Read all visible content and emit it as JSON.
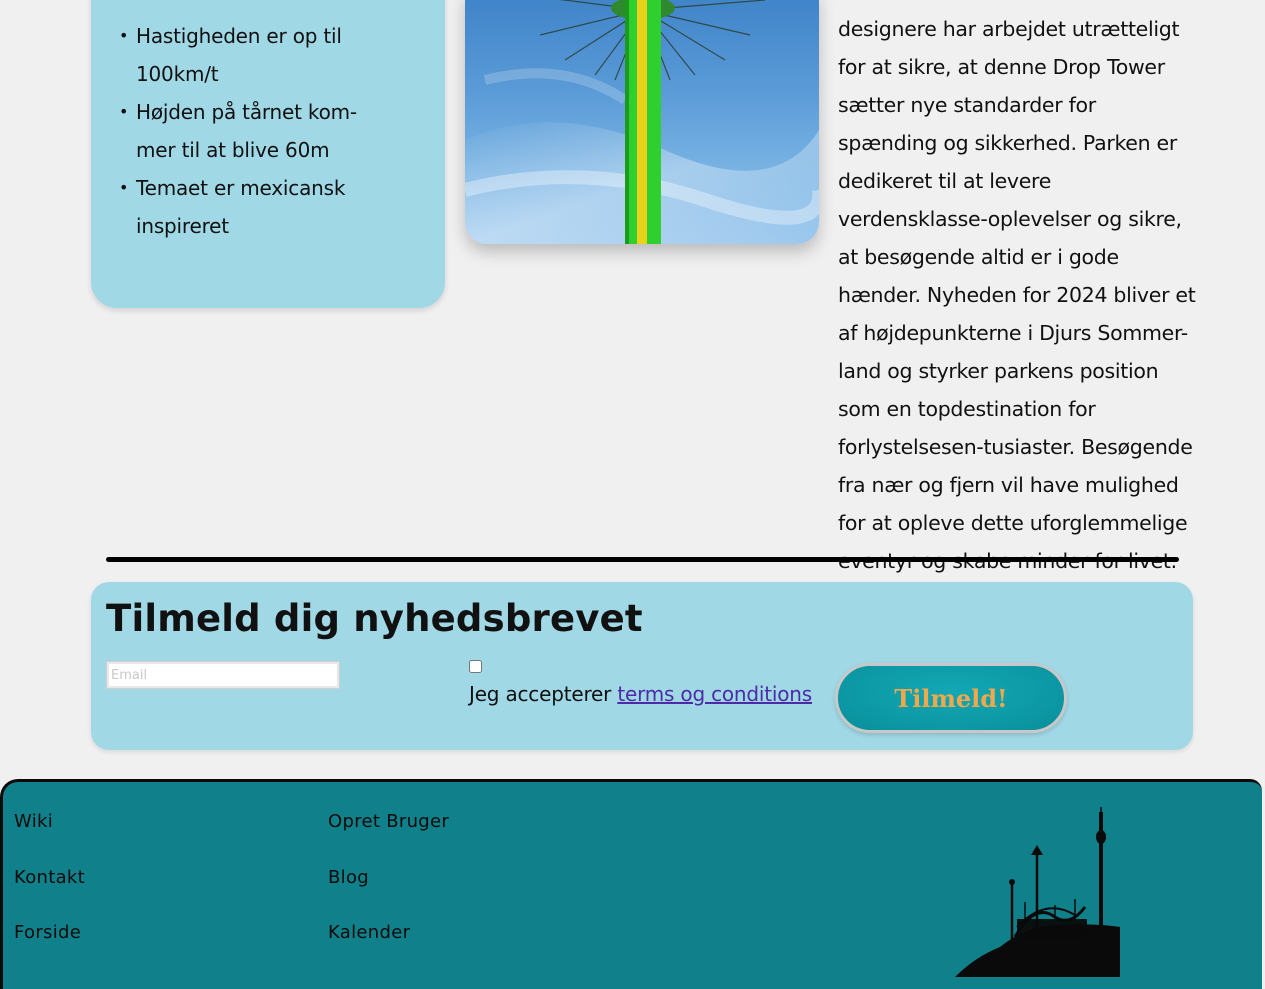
{
  "info_box": {
    "bullets": [
      "Hastigheden er op til 100km/t",
      "Højden på tårnet kom-mer til at blive 60m",
      "Temaet er mexicansk inspireret"
    ]
  },
  "article": {
    "text": "designere har arbejdet utrætteligt for at sikre, at denne Drop Tower sætter nye standarder for spænding og sikkerhed. Parken er dedikeret til at levere verdensklasse-oplevelser og sikre, at besøgende altid er i gode hænder. Nyheden for 2024 bliver et af højdepunkterne i Djurs Sommer-land og styrker parkens position som en topdestination for forlystelsesen-tusiaster. Besøgende fra nær og fjern vil have mulighed for at opleve dette uforglemmelige eventyr og skabe minder for livet."
  },
  "newsletter": {
    "title": "Tilmeld dig nyhedsbrevet",
    "email_placeholder": "Email",
    "accept_prefix": "Jeg accepterer ",
    "terms_link": "terms og conditions",
    "submit_label": "Tilmeld!"
  },
  "footer": {
    "links_col1": [
      "Wiki",
      "Kontakt",
      "Forside"
    ],
    "links_col2": [
      "Opret Bruger",
      "Blog",
      "Kalender"
    ]
  },
  "colors": {
    "panel": "#a1d8e6",
    "footer": "#10808a",
    "button": "#0b97a3",
    "button_text": "#f0a84a",
    "link": "#4b2ba8"
  },
  "icons": [
    "drop-tower-photo",
    "amusement-park-silhouette"
  ]
}
